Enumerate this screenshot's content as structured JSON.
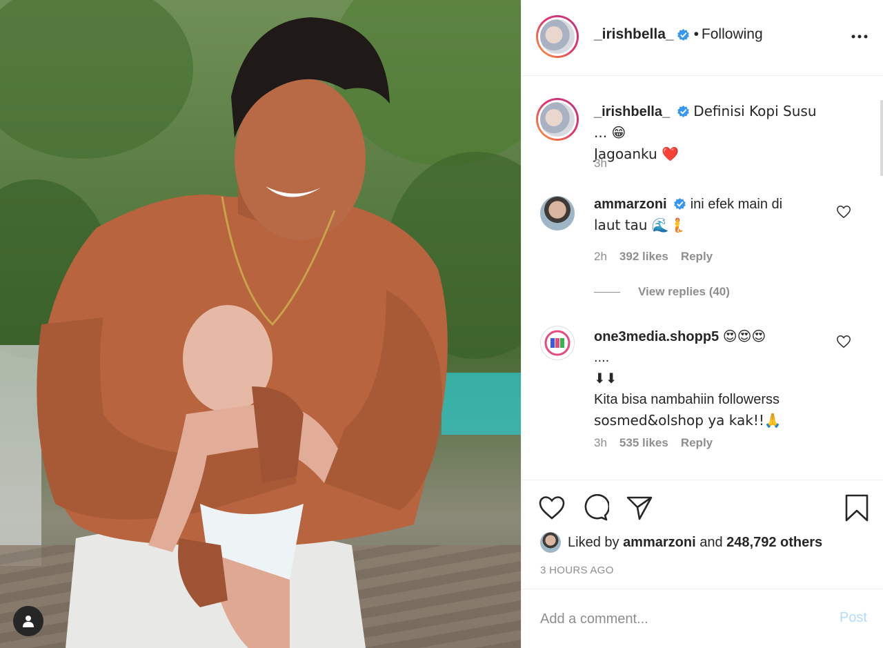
{
  "post": {
    "author": "_irishbella_",
    "follow_dot": "•",
    "follow_status": "Following",
    "more_icon": "more-horizontal-icon"
  },
  "caption": {
    "username": "_irishbella_",
    "text_line1": "Definisi Kopi Susu ... 😁",
    "text_line2": "Jagoanku ❤️",
    "time": "3h"
  },
  "comments": [
    {
      "username": "ammarzoni",
      "verified": true,
      "text_line1": "ini efek main di",
      "text_line2": "laut tau 🌊🧜",
      "time": "2h",
      "likes": "392 likes",
      "reply": "Reply",
      "view_replies": "View replies (40)"
    },
    {
      "username": "one3media.shopp5",
      "verified": false,
      "text_emoji": "😍😍😍",
      "text_line2": "....",
      "text_line3": "⬇⬇",
      "text_line4": "Kita bisa nambahiin followerss",
      "text_line5": "sosmed&olshop ya kak!!🙏",
      "time": "3h",
      "likes": "535 likes",
      "reply": "Reply"
    }
  ],
  "liked_by": {
    "prefix": "Liked by",
    "user": "ammarzoni",
    "and": "and",
    "others": "248,792 others"
  },
  "posted_ago": "3 HOURS AGO",
  "add_comment": {
    "placeholder": "Add a comment...",
    "post_label": "Post"
  },
  "colors": {
    "verified_blue": "#3897f0",
    "post_disabled": "#b3dbff",
    "muted_text": "#8e8e8e",
    "border": "#efefef"
  }
}
